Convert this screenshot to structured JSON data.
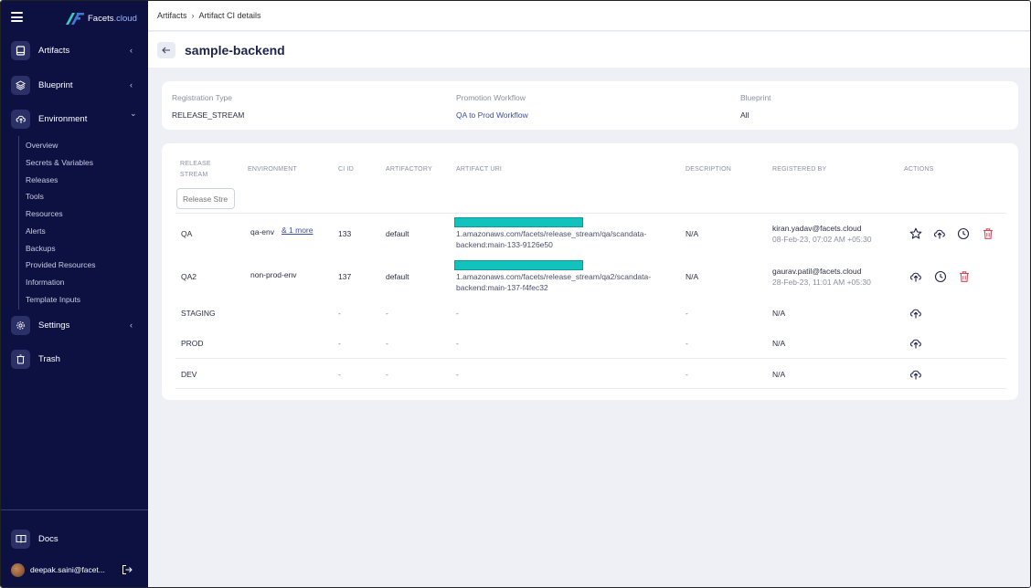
{
  "sidebar": {
    "logo": {
      "prefix": "Facets",
      "suffix": ".cloud"
    },
    "items": [
      {
        "label": "Artifacts",
        "chevron": "‹"
      },
      {
        "label": "Blueprint",
        "chevron": "‹"
      },
      {
        "label": "Environment",
        "chevron": "⌄"
      },
      {
        "label": "Settings",
        "chevron": "‹"
      },
      {
        "label": "Trash"
      }
    ],
    "environment_sub": [
      "Overview",
      "Secrets & Variables",
      "Releases",
      "Tools",
      "Resources",
      "Alerts",
      "Backups",
      "Provided Resources",
      "Information",
      "Template Inputs"
    ],
    "docs_label": "Docs",
    "user": "deepak.saini@facet..."
  },
  "breadcrumb": {
    "root": "Artifacts",
    "current": "Artifact CI details"
  },
  "page_title": "sample-backend",
  "info": {
    "registration_type_label": "Registration Type",
    "registration_type": "RELEASE_STREAM",
    "promotion_workflow_label": "Promotion Workflow",
    "promotion_workflow": "QA to Prod Workflow",
    "blueprint_label": "Blueprint",
    "blueprint": "All"
  },
  "table": {
    "headers": {
      "release_stream_1": "RELEASE",
      "release_stream_2": "STREAM",
      "environment": "ENVIRONMENT",
      "ci_id": "CI ID",
      "artifactory": "ARTIFACTORY",
      "artifact_uri": "ARTIFACT URI",
      "description": "DESCRIPTION",
      "registered_by": "REGISTERED BY",
      "actions": "ACTIONS"
    },
    "filter_placeholder": "Release Stre",
    "rows": [
      {
        "stream": "QA",
        "environment": "qa-env",
        "more": "& 1 more",
        "ci_id": "133",
        "artifactory": "default",
        "uri_1": "1.amazonaws.com/facets/release_stream/qa/scandata-",
        "uri_2": "backend:main-133-9126e50",
        "description": "N/A",
        "registered_by": "kiran.yadav@facets.cloud",
        "registered_at": "08-Feb-23, 07:02 AM +05:30"
      },
      {
        "stream": "QA2",
        "environment": "non-prod-env",
        "more": "",
        "ci_id": "137",
        "artifactory": "default",
        "uri_1": "1.amazonaws.com/facets/release_stream/qa2/scandata-",
        "uri_2": "backend:main-137-f4fec32",
        "description": "N/A",
        "registered_by": "gaurav.patil@facets.cloud",
        "registered_at": "28-Feb-23, 11:01 AM +05:30"
      },
      {
        "stream": "STAGING",
        "ci_id": "-",
        "artifactory": "-",
        "uri_1": "-",
        "description": "-",
        "registered_by": "N/A"
      },
      {
        "stream": "PROD",
        "ci_id": "-",
        "artifactory": "-",
        "uri_1": "-",
        "description": "-",
        "registered_by": "N/A"
      },
      {
        "stream": "DEV",
        "ci_id": "-",
        "artifactory": "-",
        "uri_1": "-",
        "description": "-",
        "registered_by": "N/A"
      }
    ]
  },
  "colors": {
    "sidebar_bg": "#0d1142",
    "accent_teal": "#12c3bd",
    "delete_red": "#d64a5b",
    "page_bg": "#eef0f5"
  },
  "icons": {
    "row_actions_qa": [
      "star-icon",
      "upload-icon",
      "history-icon",
      "delete-icon"
    ],
    "row_actions_qa2": [
      "upload-icon",
      "history-icon",
      "delete-icon"
    ],
    "row_actions_other": [
      "upload-icon"
    ]
  }
}
